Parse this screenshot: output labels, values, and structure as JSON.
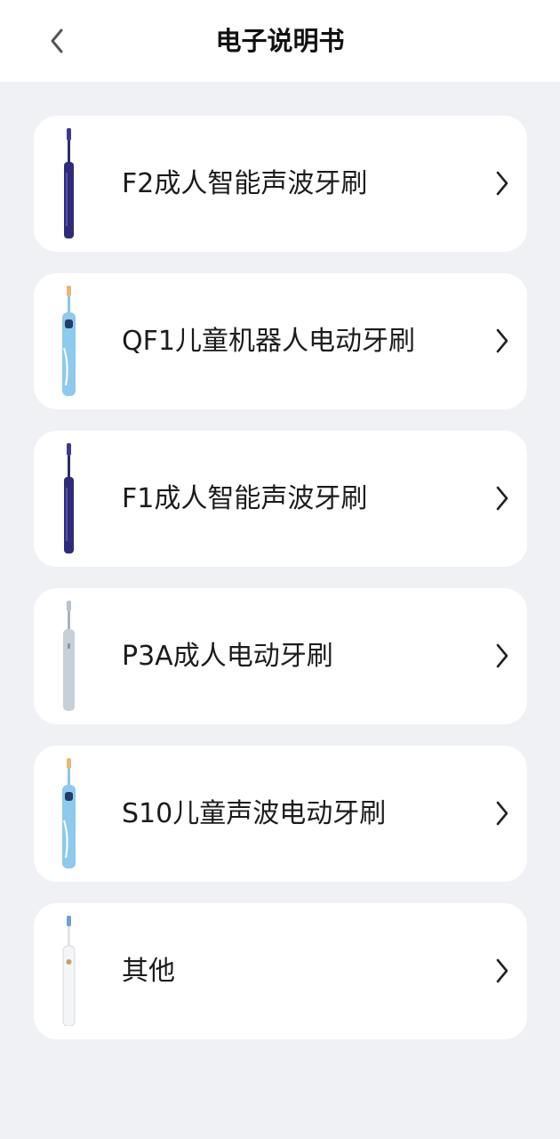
{
  "header": {
    "title": "电子说明书",
    "back_icon": "chevron-left-icon"
  },
  "colors": {
    "background": "#eff1f5",
    "card": "#ffffff",
    "text": "#1c1c1c"
  },
  "items": [
    {
      "label": "F2成人智能声波牙刷",
      "image": "toothbrush-purple",
      "chevron": "chevron-right-icon"
    },
    {
      "label": "QF1儿童机器人电动牙刷",
      "image": "toothbrush-kids-blue",
      "chevron": "chevron-right-icon"
    },
    {
      "label": "F1成人智能声波牙刷",
      "image": "toothbrush-purple",
      "chevron": "chevron-right-icon"
    },
    {
      "label": "P3A成人电动牙刷",
      "image": "toothbrush-grey",
      "chevron": "chevron-right-icon"
    },
    {
      "label": "S10儿童声波电动牙刷",
      "image": "toothbrush-kids-blue",
      "chevron": "chevron-right-icon"
    },
    {
      "label": "其他",
      "image": "toothbrush-white",
      "chevron": "chevron-right-icon"
    }
  ]
}
